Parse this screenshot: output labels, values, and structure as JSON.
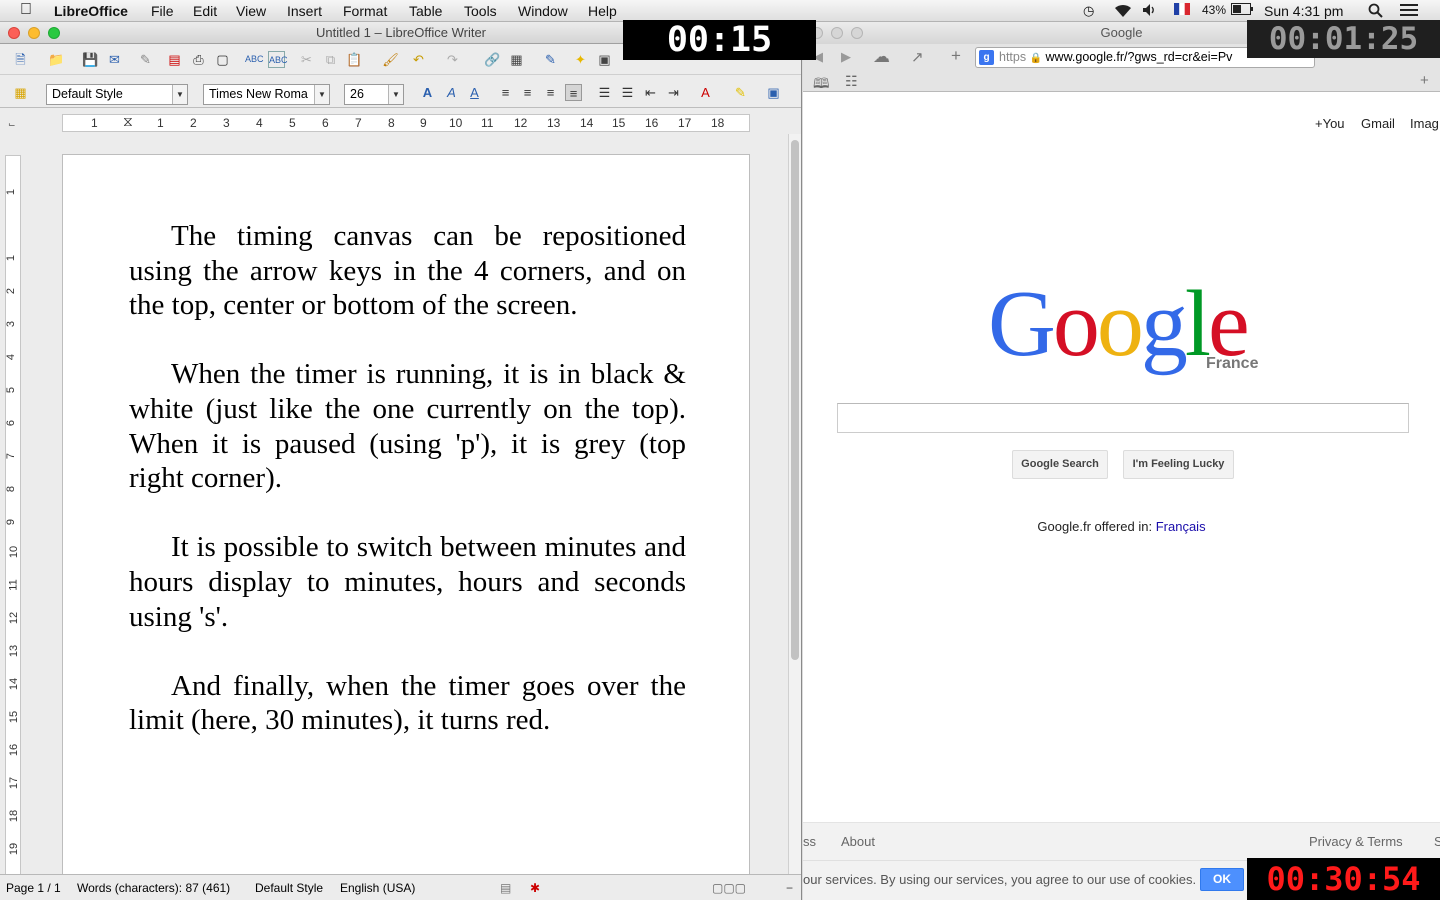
{
  "menubar": {
    "app_name": "LibreOffice",
    "menus": [
      "File",
      "Edit",
      "View",
      "Insert",
      "Format",
      "Table",
      "Tools",
      "Window",
      "Help"
    ],
    "battery": "43%",
    "clock": "Sun 4:31 pm"
  },
  "writer": {
    "title": "Untitled 1 – LibreOffice Writer",
    "paragraph_style": "Default Style",
    "font_name": "Times New Roma",
    "font_size": "26",
    "ruler_h": [
      "1",
      "1",
      "2",
      "3",
      "4",
      "5",
      "6",
      "7",
      "8",
      "9",
      "10",
      "11",
      "12",
      "13",
      "14",
      "15",
      "16",
      "17",
      "18"
    ],
    "ruler_v": [
      "1",
      "1",
      "2",
      "3",
      "4",
      "5",
      "6",
      "7",
      "8",
      "9",
      "10",
      "11",
      "12",
      "13",
      "14",
      "15",
      "16",
      "17",
      "18",
      "19"
    ],
    "paragraphs": [
      "The timing canvas can be repositioned using the arrow keys in the 4 corners, and on the top, center or bottom of the screen.",
      "When the timer is running, it is in black & white (just like the one currently on the top). When it is paused (using 'p'), it is grey (top right corner).",
      "It is possible to switch between minutes and hours display to minutes, hours and seconds using 's'.",
      "And finally, when the timer goes over the limit (here, 30 minutes), it turns red."
    ],
    "status": {
      "page": "Page 1 / 1",
      "words": "Words (characters): 87 (461)",
      "style": "Default Style",
      "language": "English (USA)"
    }
  },
  "browser": {
    "title": "Google",
    "url_scheme": "https",
    "url": "www.google.fr/?gws_rd=cr&ei=Pv",
    "top_links": [
      "+You",
      "Gmail",
      "Imag"
    ],
    "logo_sub": "France",
    "search_button": "Google Search",
    "lucky_button": "I'm Feeling Lucky",
    "offered_in": "Google.fr offered in:",
    "offered_lang": "Français",
    "footer_left_partial": "ss",
    "footer_about": "About",
    "footer_privacy": "Privacy & Terms",
    "footer_right_partial": "S",
    "cookie_text": "our services. By using our services, you agree to our use of cookies.",
    "cookie_ok": "OK"
  },
  "timers": {
    "top_center": "00:15",
    "top_right": "00:01:25",
    "bottom_right": "00:30:54",
    "colors": {
      "running_bg": "#000000",
      "running_fg": "#ffffff",
      "paused_bg": "#1f1f1f",
      "paused_fg": "#9a9a9a",
      "over_bg": "#000000",
      "over_fg": "#ff1a1a"
    }
  },
  "icons": [
    "apple-icon",
    "time-machine-icon",
    "wifi-icon",
    "volume-icon",
    "flag-fr-icon",
    "battery-icon",
    "spotlight-icon",
    "notification-icon"
  ]
}
